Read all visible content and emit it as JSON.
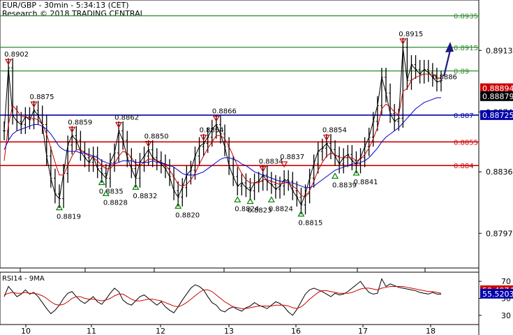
{
  "header": {
    "line1": "EUR/GBP - 30min - 5:34:13 (CET)",
    "line2": "Research © 2018 TRADING CENTRAL"
  },
  "colors": {
    "resistance": "#cc0000",
    "support": "#008000",
    "pivot": "#0000aa",
    "ma_red": "#cc0000",
    "ma_blue": "#0000cc",
    "arrow": "#1a1a80",
    "green_level": "#2e8b2e",
    "price_bar": "#000000"
  },
  "chart_data": [
    {
      "type": "line",
      "title": "",
      "x_ticks": [
        "10",
        "11",
        "12",
        "13",
        "16",
        "17",
        "18"
      ],
      "y_ticks": [
        "0.8913",
        "0.8874",
        "0.8836",
        "0.8797"
      ],
      "ylim": [
        0.8775,
        0.8945
      ],
      "series": [
        {
          "values": [
            0.8862,
            0.8902,
            0.8872,
            0.8868,
            0.8866,
            0.8871,
            0.8869,
            0.8875,
            0.8872,
            0.8866,
            0.8846,
            0.8832,
            0.8822,
            0.8819,
            0.8835,
            0.8853,
            0.8859,
            0.8856,
            0.8849,
            0.8845,
            0.8842,
            0.8846,
            0.8838,
            0.8835,
            0.8832,
            0.8842,
            0.8848,
            0.8862,
            0.8856,
            0.8845,
            0.8838,
            0.8832,
            0.8842,
            0.8846,
            0.885,
            0.8845,
            0.8843,
            0.8841,
            0.8838,
            0.8833,
            0.8824,
            0.882,
            0.8826,
            0.8834,
            0.8837,
            0.8846,
            0.8852,
            0.8854,
            0.8858,
            0.8863,
            0.8866,
            0.886,
            0.8852,
            0.884,
            0.8833,
            0.8827,
            0.8829,
            0.8826,
            0.8824,
            0.8829,
            0.883,
            0.8834,
            0.883,
            0.8828,
            0.8825,
            0.8827,
            0.8831,
            0.883,
            0.8824,
            0.882,
            0.8815,
            0.8822,
            0.8832,
            0.8841,
            0.8849,
            0.8851,
            0.8854,
            0.885,
            0.8846,
            0.8841,
            0.8845,
            0.8847,
            0.8843,
            0.8841,
            0.8845,
            0.8852,
            0.8858,
            0.8868,
            0.8878,
            0.8896,
            0.8886,
            0.8873,
            0.8868,
            0.887,
            0.8915,
            0.8894,
            0.8904,
            0.8901,
            0.8898,
            0.8901,
            0.8899,
            0.8896,
            0.8893,
            0.8894
          ]
        }
      ],
      "moving_averages": [
        {
          "values": [
            0.8843,
            0.8866,
            0.8878,
            0.8875,
            0.8871,
            0.8871,
            0.887,
            0.887,
            0.8869,
            0.8866,
            0.886,
            0.8851,
            0.8842,
            0.8834,
            0.8834,
            0.884,
            0.8846,
            0.885,
            0.885,
            0.8848,
            0.8846,
            0.8845,
            0.8843,
            0.884,
            0.8838,
            0.8838,
            0.8841,
            0.8846,
            0.8849,
            0.8848,
            0.8845,
            0.8841,
            0.884,
            0.8842,
            0.8844,
            0.8844,
            0.8843,
            0.8842,
            0.884,
            0.8837,
            0.8833,
            0.8828,
            0.8827,
            0.8828,
            0.8831,
            0.8835,
            0.8841,
            0.8846,
            0.8851,
            0.8855,
            0.8859,
            0.8859,
            0.8857,
            0.8852,
            0.8846,
            0.884,
            0.8835,
            0.8831,
            0.8829,
            0.8829,
            0.8829,
            0.8831,
            0.8831,
            0.883,
            0.8829,
            0.8828,
            0.8829,
            0.8829,
            0.8827,
            0.8825,
            0.8821,
            0.882,
            0.8824,
            0.883,
            0.8837,
            0.8842,
            0.8846,
            0.8848,
            0.8847,
            0.8845,
            0.8845,
            0.8845,
            0.8845,
            0.8843,
            0.8844,
            0.8847,
            0.8851,
            0.8857,
            0.8864,
            0.8876,
            0.8879,
            0.8877,
            0.8874,
            0.8872,
            0.8887,
            0.8889,
            0.8894,
            0.8896,
            0.8897,
            0.8898,
            0.8898,
            0.8898,
            0.8896,
            0.8895
          ]
        },
        {
          "values": [
            0.885,
            0.8856,
            0.886,
            0.8862,
            0.8863,
            0.8864,
            0.8865,
            0.8866,
            0.8866,
            0.8865,
            0.8863,
            0.886,
            0.8856,
            0.8852,
            0.885,
            0.8849,
            0.8849,
            0.8849,
            0.8848,
            0.8848,
            0.8847,
            0.8846,
            0.8845,
            0.8843,
            0.8842,
            0.8841,
            0.8841,
            0.8842,
            0.8843,
            0.8843,
            0.8843,
            0.8842,
            0.8842,
            0.8842,
            0.8842,
            0.8843,
            0.8842,
            0.8842,
            0.8841,
            0.884,
            0.8839,
            0.8837,
            0.8835,
            0.8834,
            0.8834,
            0.8834,
            0.8835,
            0.8836,
            0.8838,
            0.884,
            0.8842,
            0.8844,
            0.8845,
            0.8845,
            0.8844,
            0.8843,
            0.8841,
            0.884,
            0.8838,
            0.8836,
            0.8835,
            0.8834,
            0.8833,
            0.8832,
            0.8831,
            0.883,
            0.883,
            0.8829,
            0.8829,
            0.8828,
            0.8827,
            0.8826,
            0.8826,
            0.8827,
            0.8829,
            0.8831,
            0.8833,
            0.8835,
            0.8837,
            0.8838,
            0.8839,
            0.884,
            0.8841,
            0.8841,
            0.8842,
            0.8843,
            0.8845,
            0.8848,
            0.8851,
            0.8855,
            0.8858,
            0.886,
            0.8862,
            0.8864,
            0.8867,
            0.887,
            0.8873,
            0.8876,
            0.8878,
            0.888,
            0.8881,
            0.8882,
            0.8883,
            0.8883
          ]
        }
      ],
      "levels": [
        {
          "value": 0.8935,
          "label": "0.8935",
          "role": "support-color"
        },
        {
          "value": 0.8915,
          "label": "0.8915",
          "role": "support-color"
        },
        {
          "value": 0.89,
          "label": "0.89",
          "role": "support-color"
        },
        {
          "value": 0.8872,
          "label": "0.887",
          "role": "pivot"
        },
        {
          "value": 0.8855,
          "label": "0.8855",
          "role": "resistance"
        },
        {
          "value": 0.884,
          "label": "0.884",
          "role": "resistance"
        }
      ],
      "price_tags": [
        {
          "value": 0.8889,
          "label": "0.88894",
          "color": "#cc0000"
        },
        {
          "value": 0.8884,
          "label": "0.88879",
          "color": "#000000"
        },
        {
          "value": 0.8872,
          "label": "0.88725",
          "color": "#0000aa"
        }
      ],
      "annotations": [
        {
          "i": 1,
          "value": 0.8902,
          "label": "0.8902",
          "kind": "high"
        },
        {
          "i": 7,
          "value": 0.8875,
          "label": "0.8875",
          "kind": "high"
        },
        {
          "i": 13,
          "value": 0.8819,
          "label": "0.8819",
          "kind": "low"
        },
        {
          "i": 16,
          "value": 0.8859,
          "label": "0.8859",
          "kind": "high"
        },
        {
          "i": 23,
          "value": 0.8835,
          "label": "0.8835",
          "kind": "low"
        },
        {
          "i": 27,
          "value": 0.8862,
          "label": "0.8862",
          "kind": "high"
        },
        {
          "i": 24,
          "value": 0.8828,
          "label": "0.8828",
          "kind": "low"
        },
        {
          "i": 31,
          "value": 0.8832,
          "label": "0.8832",
          "kind": "low"
        },
        {
          "i": 34,
          "value": 0.885,
          "label": "0.8850",
          "kind": "high"
        },
        {
          "i": 41,
          "value": 0.882,
          "label": "0.8820",
          "kind": "low"
        },
        {
          "i": 47,
          "value": 0.8854,
          "label": "0.8854",
          "kind": "high"
        },
        {
          "i": 50,
          "value": 0.8866,
          "label": "0.8866",
          "kind": "high"
        },
        {
          "i": 55,
          "value": 0.8824,
          "label": "0.8824",
          "kind": "low"
        },
        {
          "i": 61,
          "value": 0.8834,
          "label": "0.8834",
          "kind": "high"
        },
        {
          "i": 58,
          "value": 0.8823,
          "label": "0.8823",
          "kind": "low"
        },
        {
          "i": 63,
          "value": 0.8824,
          "label": "0.8824",
          "kind": "low"
        },
        {
          "i": 66,
          "value": 0.8837,
          "label": "0.8837",
          "kind": "high"
        },
        {
          "i": 70,
          "value": 0.8815,
          "label": "0.8815",
          "kind": "low"
        },
        {
          "i": 76,
          "value": 0.8854,
          "label": "0.8854",
          "kind": "high"
        },
        {
          "i": 78,
          "value": 0.8839,
          "label": "0.8839",
          "kind": "low"
        },
        {
          "i": 83,
          "value": 0.8841,
          "label": "0.8841",
          "kind": "low"
        },
        {
          "i": 94,
          "value": 0.8915,
          "label": "0.8915",
          "kind": "high"
        },
        {
          "i": 102,
          "value": 0.8886,
          "label": "0.8886",
          "kind": "note"
        }
      ]
    },
    {
      "type": "line",
      "title": "RSI14 - 9MA",
      "ylim": [
        20,
        80
      ],
      "y_ticks": [
        "70",
        "50",
        "30"
      ],
      "price_tags": [
        {
          "value": 59.49,
          "label": "59.4974",
          "color": "#cc0000"
        },
        {
          "value": 55.52,
          "label": "55.5203",
          "color": "#0000aa"
        }
      ],
      "series": [
        {
          "name": "RSI14",
          "values": [
            52,
            64,
            58,
            52,
            55,
            60,
            55,
            57,
            52,
            45,
            38,
            32,
            36,
            42,
            50,
            56,
            58,
            52,
            47,
            44,
            48,
            52,
            46,
            43,
            49,
            56,
            62,
            58,
            48,
            44,
            42,
            47,
            52,
            54,
            50,
            46,
            42,
            46,
            40,
            36,
            33,
            40,
            48,
            55,
            62,
            66,
            64,
            60,
            52,
            45,
            42,
            36,
            34,
            38,
            40,
            37,
            35,
            39,
            41,
            45,
            42,
            40,
            38,
            42,
            46,
            44,
            40,
            34,
            30,
            37,
            46,
            55,
            60,
            62,
            60,
            58,
            55,
            52,
            56,
            54,
            55,
            58,
            62,
            66,
            70,
            63,
            57,
            55,
            56,
            73,
            64,
            67,
            65,
            63,
            62,
            61,
            60,
            59,
            57,
            56,
            55,
            57,
            55,
            55
          ]
        },
        {
          "name": "9MA",
          "values": [
            54,
            56,
            57,
            56,
            56,
            57,
            56,
            56,
            55,
            53,
            50,
            46,
            43,
            42,
            43,
            46,
            50,
            52,
            52,
            50,
            49,
            49,
            48,
            47,
            48,
            50,
            53,
            55,
            55,
            52,
            49,
            47,
            47,
            48,
            49,
            49,
            48,
            47,
            45,
            43,
            41,
            40,
            42,
            45,
            49,
            53,
            57,
            60,
            60,
            58,
            54,
            50,
            46,
            43,
            40,
            39,
            38,
            38,
            39,
            40,
            41,
            41,
            41,
            41,
            42,
            42,
            42,
            41,
            39,
            38,
            40,
            44,
            49,
            53,
            57,
            59,
            59,
            58,
            57,
            56,
            56,
            56,
            57,
            59,
            61,
            62,
            62,
            61,
            60,
            62,
            63,
            64,
            64,
            64,
            64,
            63,
            62,
            61,
            60,
            59,
            58,
            58,
            57,
            56
          ]
        }
      ]
    }
  ]
}
